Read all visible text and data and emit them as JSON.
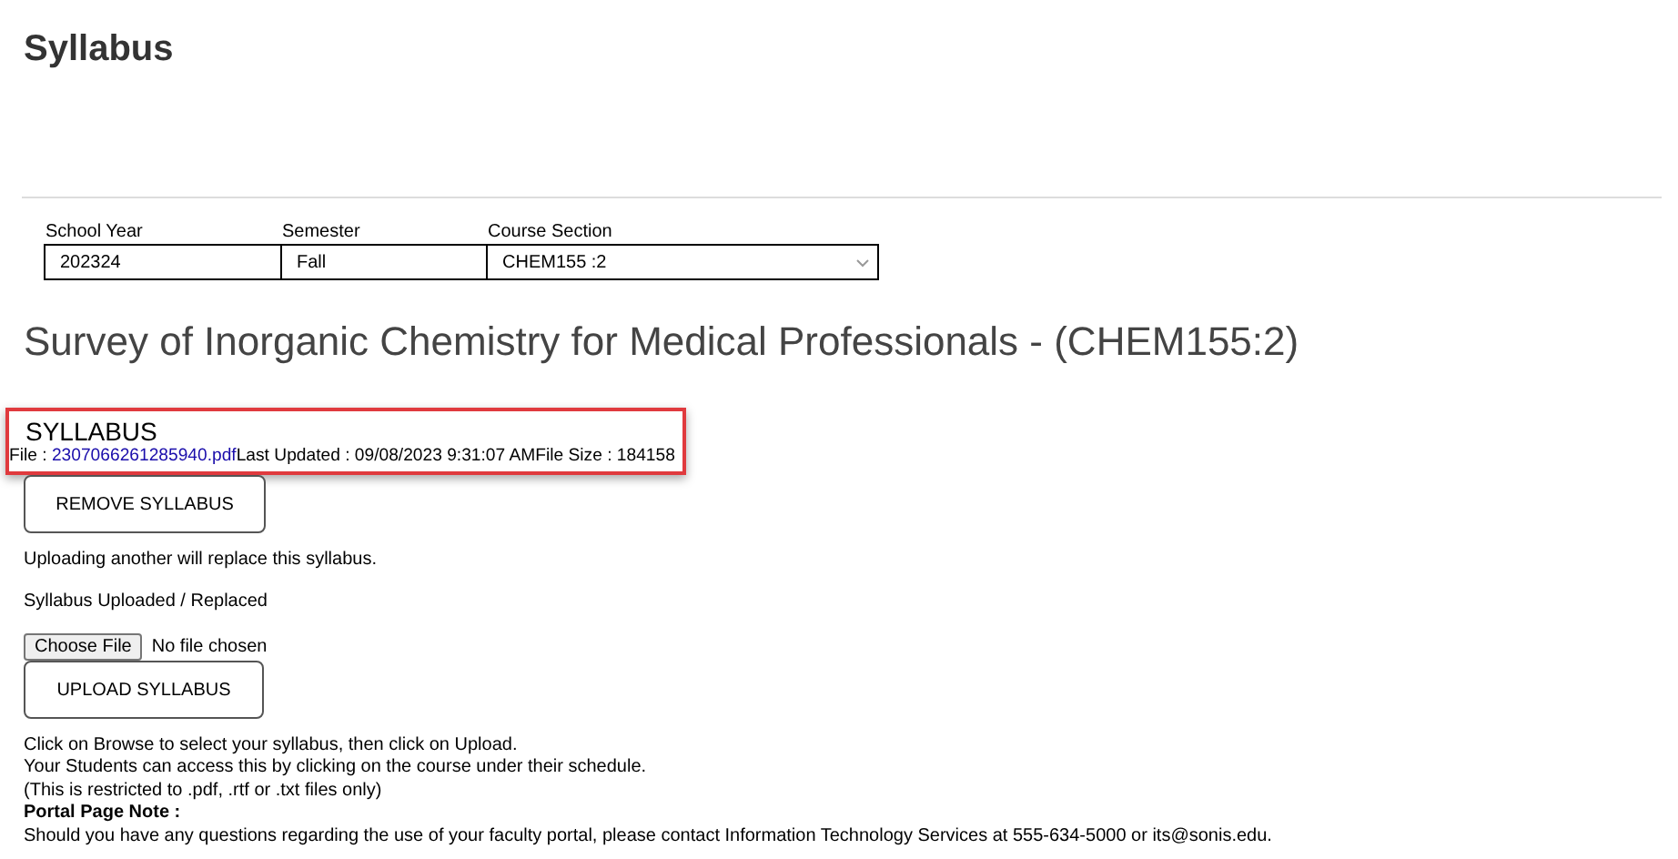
{
  "page": {
    "title": "Syllabus"
  },
  "filters": [
    {
      "label": "School Year",
      "value": "202324",
      "kind": "text"
    },
    {
      "label": "Semester",
      "value": "Fall",
      "kind": "text"
    },
    {
      "label": "Course Section",
      "value": "CHEM155 :2",
      "kind": "dropdown"
    }
  ],
  "course_title": "Survey of Inorganic Chemistry for Medical Professionals - (CHEM155:2)",
  "syllabus": {
    "heading": "SYLLABUS",
    "highlighted": true,
    "file_label": "File : ",
    "file_link": "2307066261285940.pdf",
    "last_updated": "Last Updated : 09/08/2023 9:31:07 AM",
    "file_size": "File Size : 184158",
    "remove_button": "REMOVE SYLLABUS"
  },
  "replace_note": "Uploading another will replace this syllabus.",
  "status": "Syllabus Uploaded / Replaced",
  "file_input": {
    "button": "Choose File",
    "status": "No file chosen"
  },
  "upload_button": "UPLOAD SYLLABUS",
  "instructions": [
    "Click on Browse to select your syllabus, then click on Upload.",
    "Your Students can access this by clicking on the course under their schedule.",
    "(This is restricted to .pdf, .rtf or .txt files only)"
  ],
  "portal_note": {
    "heading": "Portal Page Note :",
    "text": "Should you have any questions regarding the use of your faculty portal, please contact Information Technology Services at 555-634-5000 or its@sonis.edu."
  }
}
